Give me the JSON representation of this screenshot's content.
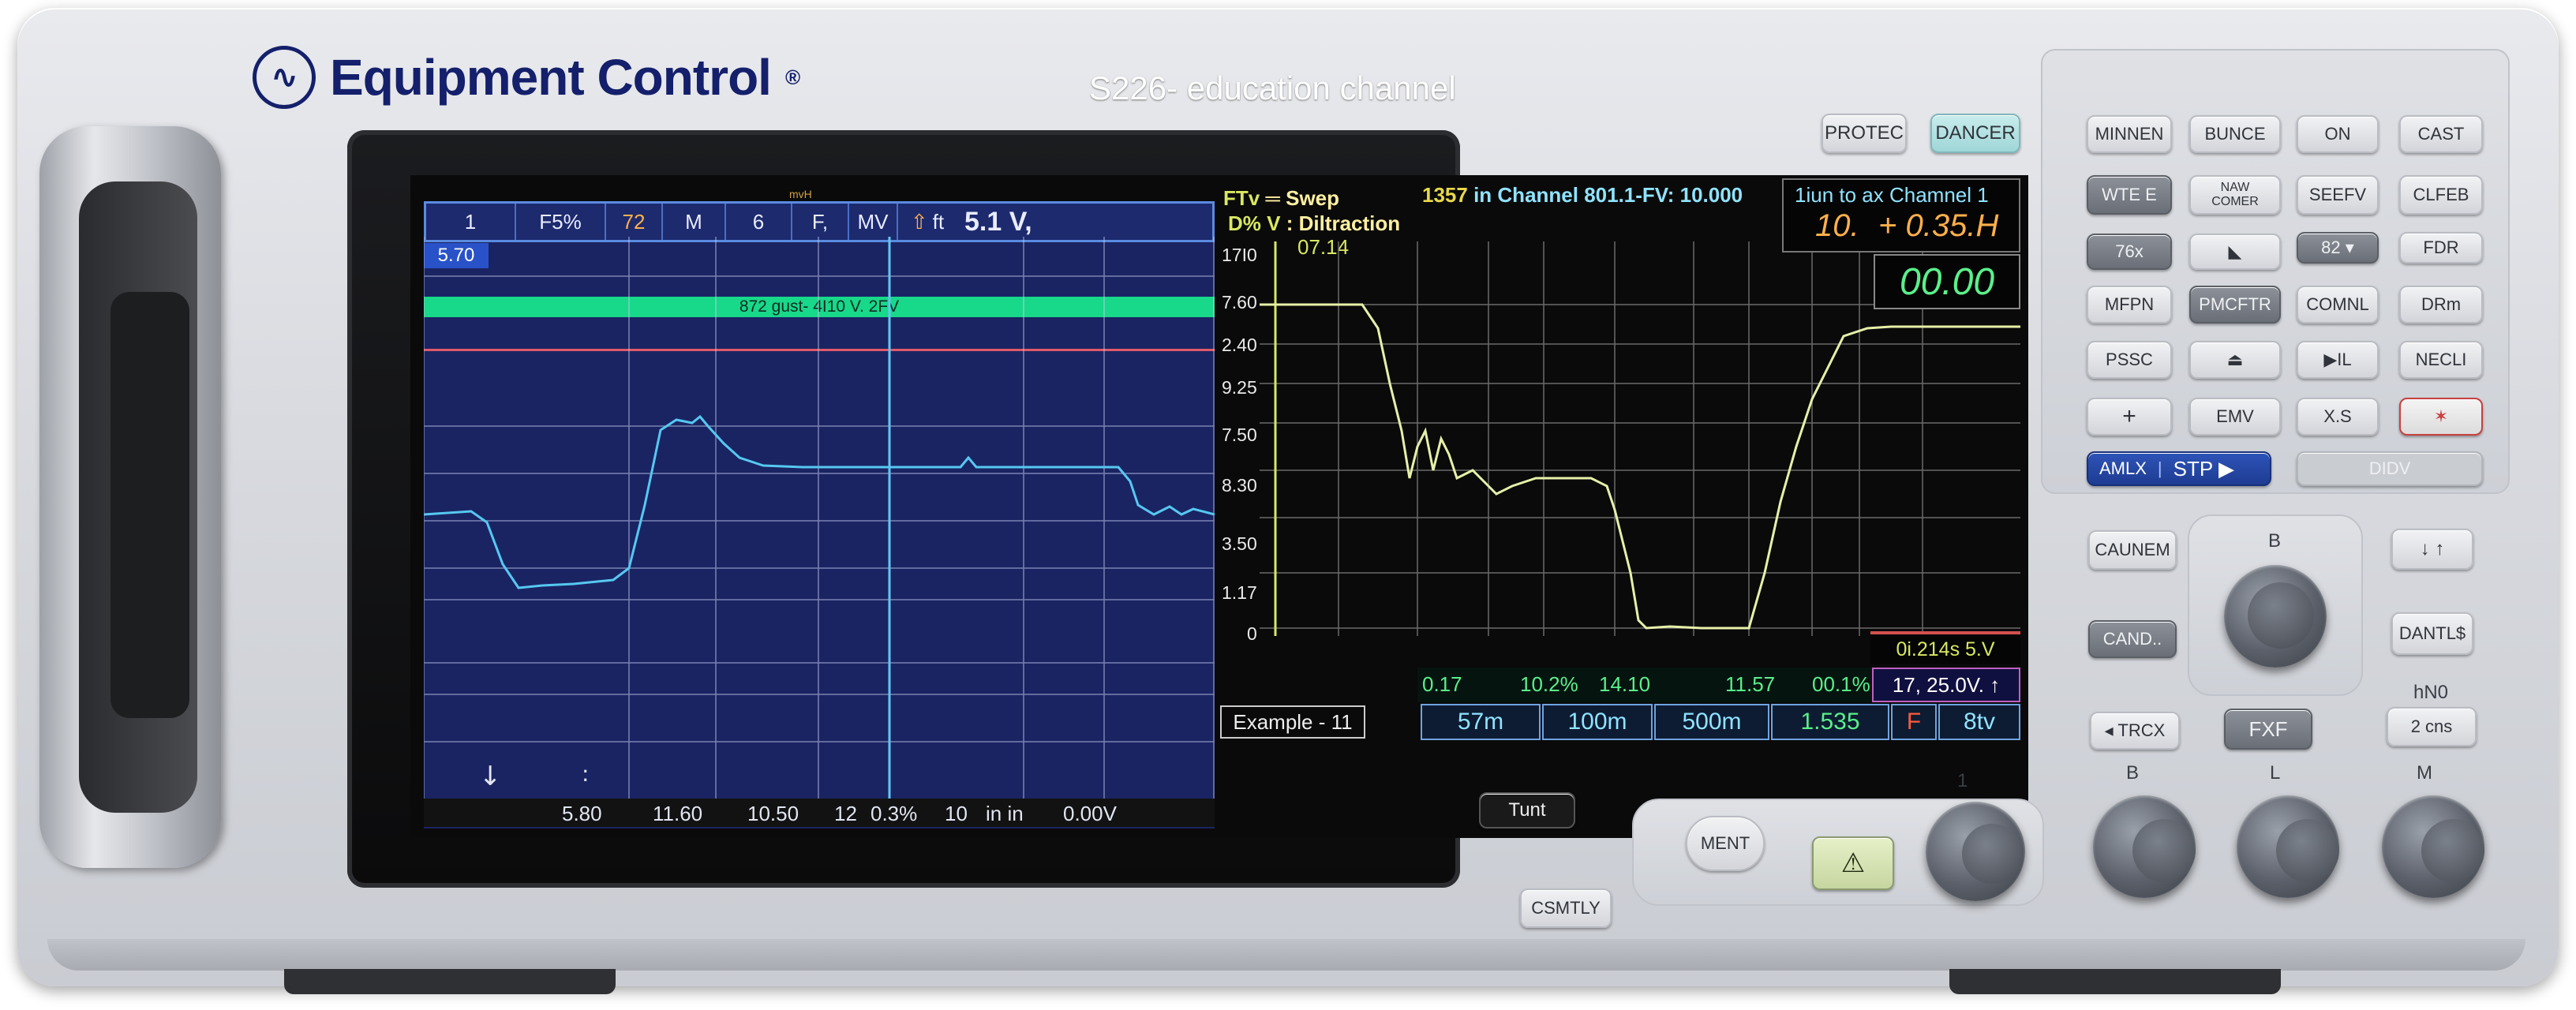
{
  "brand": {
    "name": "Equipment Control",
    "reg": "®",
    "logo_icon": "waveform-logo-icon"
  },
  "subtitle": "S226- education channel",
  "top_buttons": {
    "protec": "PROTEC",
    "dancer": "DANCER"
  },
  "left_panel": {
    "header_cells": [
      "1",
      "F5%",
      "72",
      "M",
      "6",
      "F,",
      "MV",
      "ft"
    ],
    "header_value": "5.1 V,",
    "header_small": "mvH",
    "marker": "5.70",
    "band_text": "872 gust- 4I10 V. 2FV",
    "axis_labels": [
      "5.80",
      "11.60",
      "10.50",
      "12",
      "0.3%",
      "10",
      "in in",
      "0.00V"
    ],
    "cursor_glyphs": [
      "↓",
      ":"
    ],
    "cursor_icon": "cursor-arrow-icon"
  },
  "middle_panel": {
    "mode_line1_key": "FTv",
    "mode_line1_val": "═ Swep",
    "mode_line2_key": "D% V",
    "mode_line2_val": ": Diltraction",
    "top_value": "07.14",
    "y_ticks": [
      "17I0",
      "7.60",
      "2.40",
      "9.25",
      "7.50",
      "8.30",
      "3.50",
      "1.17",
      "0"
    ],
    "example_label": "Example - 11"
  },
  "right_panel": {
    "header_text": "1357",
    "header_channel": "in Channel 801.1-FV:",
    "header_value": "10.000",
    "channel_title": "1iun to ax Chamnel 1",
    "channel_value_a": "10.",
    "channel_value_b": "+ 0.35.H",
    "big_readout": "00.00",
    "time_readout": "0i.214s 5.V",
    "stats": [
      "0.17",
      "10.2%",
      "14.10",
      "11.57",
      "00.1%"
    ],
    "stats_box": "17, 25.0V. ↑",
    "bottom_cells": [
      "57m",
      "100m",
      "500m",
      "1.535",
      "F",
      "8tv"
    ]
  },
  "keypad": {
    "rows": [
      [
        "MINNEN",
        "BUNCE",
        "ON",
        "CAST"
      ],
      [
        "WTE E",
        "NAW COMER",
        "SEEFV",
        "CLFEB"
      ],
      [
        "76x",
        "◣",
        "82 ▾",
        "FDR"
      ],
      [
        "MFPN",
        "PMCFTR",
        "COMNL",
        "DRm"
      ],
      [
        "PSSC",
        "⏏",
        "▶IL",
        "NECLI"
      ],
      [
        "+",
        "EMV",
        "X.S",
        "✶"
      ]
    ],
    "amlx": "AMLX",
    "stp": "STP ▶",
    "didv": "DIDV"
  },
  "lower_controls": {
    "caunem": "CAUNEM",
    "cand": "CAND..",
    "knob_b_label": "B",
    "updown": "↓ ↑",
    "dantls": "DANTL$",
    "trcx": "◂ TRCX",
    "fxf": "FXF",
    "hno_label": "hN0",
    "cns": "2 cns",
    "tunt": "Tunt",
    "csmtly": "CSMTLY",
    "ment": "MENT",
    "warning_icon": "warning-icon",
    "knob_labels": [
      "1",
      "B",
      "L",
      "M"
    ]
  },
  "colors": {
    "screen_left": "#1a2463",
    "trace_left": "#56c8f0",
    "trace_right": "#e6f0a8",
    "band": "#18d88a",
    "brand": "#14206b"
  }
}
